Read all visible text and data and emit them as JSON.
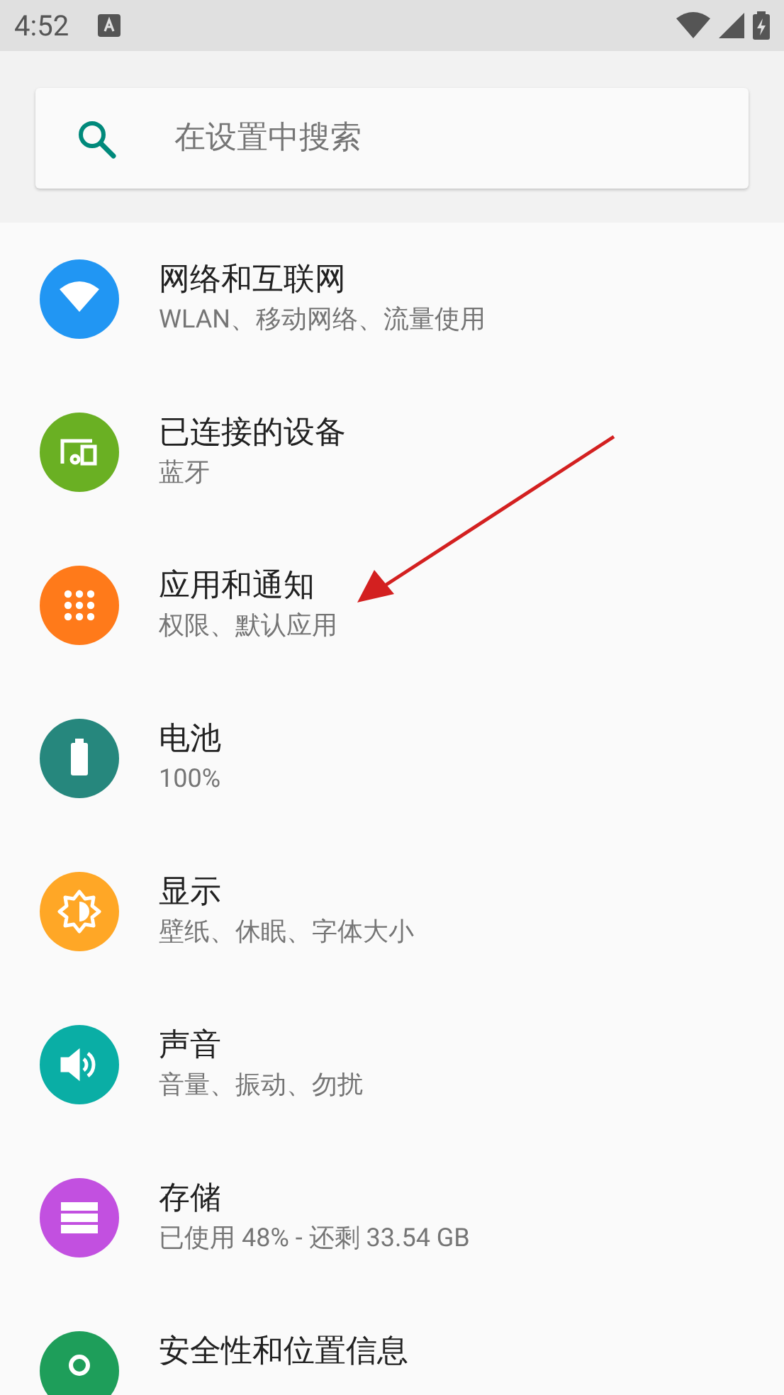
{
  "status_bar": {
    "time": "4:52"
  },
  "search": {
    "placeholder": "在设置中搜索"
  },
  "items": [
    {
      "kind": "network",
      "color": "#2196f3",
      "title": "网络和互联网",
      "subtitle": "WLAN、移动网络、流量使用"
    },
    {
      "kind": "devices",
      "color": "#6ab023",
      "title": "已连接的设备",
      "subtitle": "蓝牙"
    },
    {
      "kind": "apps",
      "color": "#ff7a1a",
      "title": "应用和通知",
      "subtitle": "权限、默认应用"
    },
    {
      "kind": "battery",
      "color": "#26877d",
      "title": "电池",
      "subtitle": "100%"
    },
    {
      "kind": "display",
      "color": "#ffa726",
      "title": "显示",
      "subtitle": "壁纸、休眠、字体大小"
    },
    {
      "kind": "sound",
      "color": "#0aaea5",
      "title": "声音",
      "subtitle": "音量、振动、勿扰"
    },
    {
      "kind": "storage",
      "color": "#c250e0",
      "title": "存储",
      "subtitle": "已使用 48% - 还剩 33.54 GB"
    },
    {
      "kind": "security",
      "color": "#1e9e5a",
      "title": "安全性和位置信息"
    }
  ]
}
